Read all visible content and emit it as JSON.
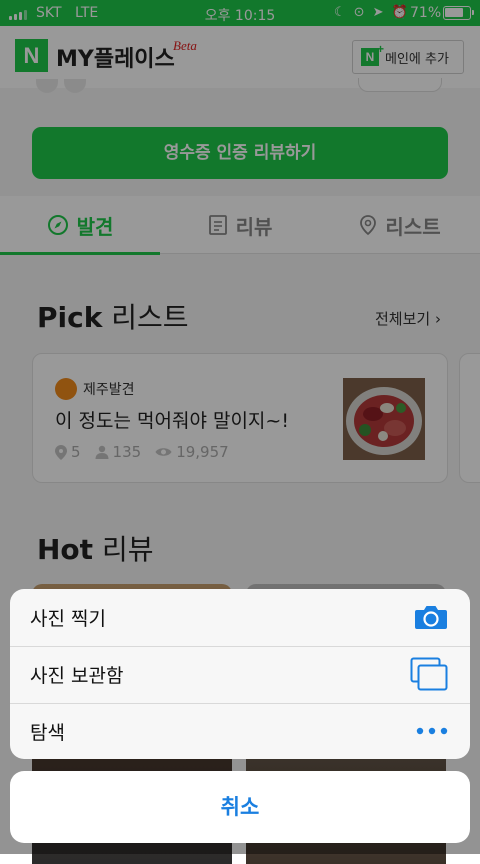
{
  "status_bar": {
    "carrier": "SKT",
    "network": "LTE",
    "time": "오후 10:15",
    "battery": "71%"
  },
  "header": {
    "logo_letter": "N",
    "title": "MY플레이스",
    "beta": "Beta",
    "add_main_label": "메인에 추가"
  },
  "receipt_button": "영수증 인증 리뷰하기",
  "tabs": [
    {
      "label": "발견",
      "icon": "compass-icon",
      "active": true
    },
    {
      "label": "리뷰",
      "icon": "document-icon",
      "active": false
    },
    {
      "label": "리스트",
      "icon": "location-pin-icon",
      "active": false
    }
  ],
  "pick": {
    "title_bold": "Pick",
    "title_rest": " 리스트",
    "see_all": "전체보기",
    "card": {
      "channel": "제주발견",
      "title": "이 정도는 먹어줘야 말이지~!",
      "places": "5",
      "followers": "135",
      "views": "19,957"
    }
  },
  "hot": {
    "title_bold": "Hot",
    "title_rest": " 리뷰"
  },
  "action_sheet": {
    "items": [
      {
        "label": "사진 찍기",
        "icon": "camera-icon"
      },
      {
        "label": "사진 보관함",
        "icon": "photo-library-icon"
      },
      {
        "label": "탐색",
        "icon": "more-dots-icon"
      }
    ],
    "cancel": "취소"
  },
  "colors": {
    "brand_green": "#1ec84a",
    "ios_blue": "#1a7fe0"
  }
}
